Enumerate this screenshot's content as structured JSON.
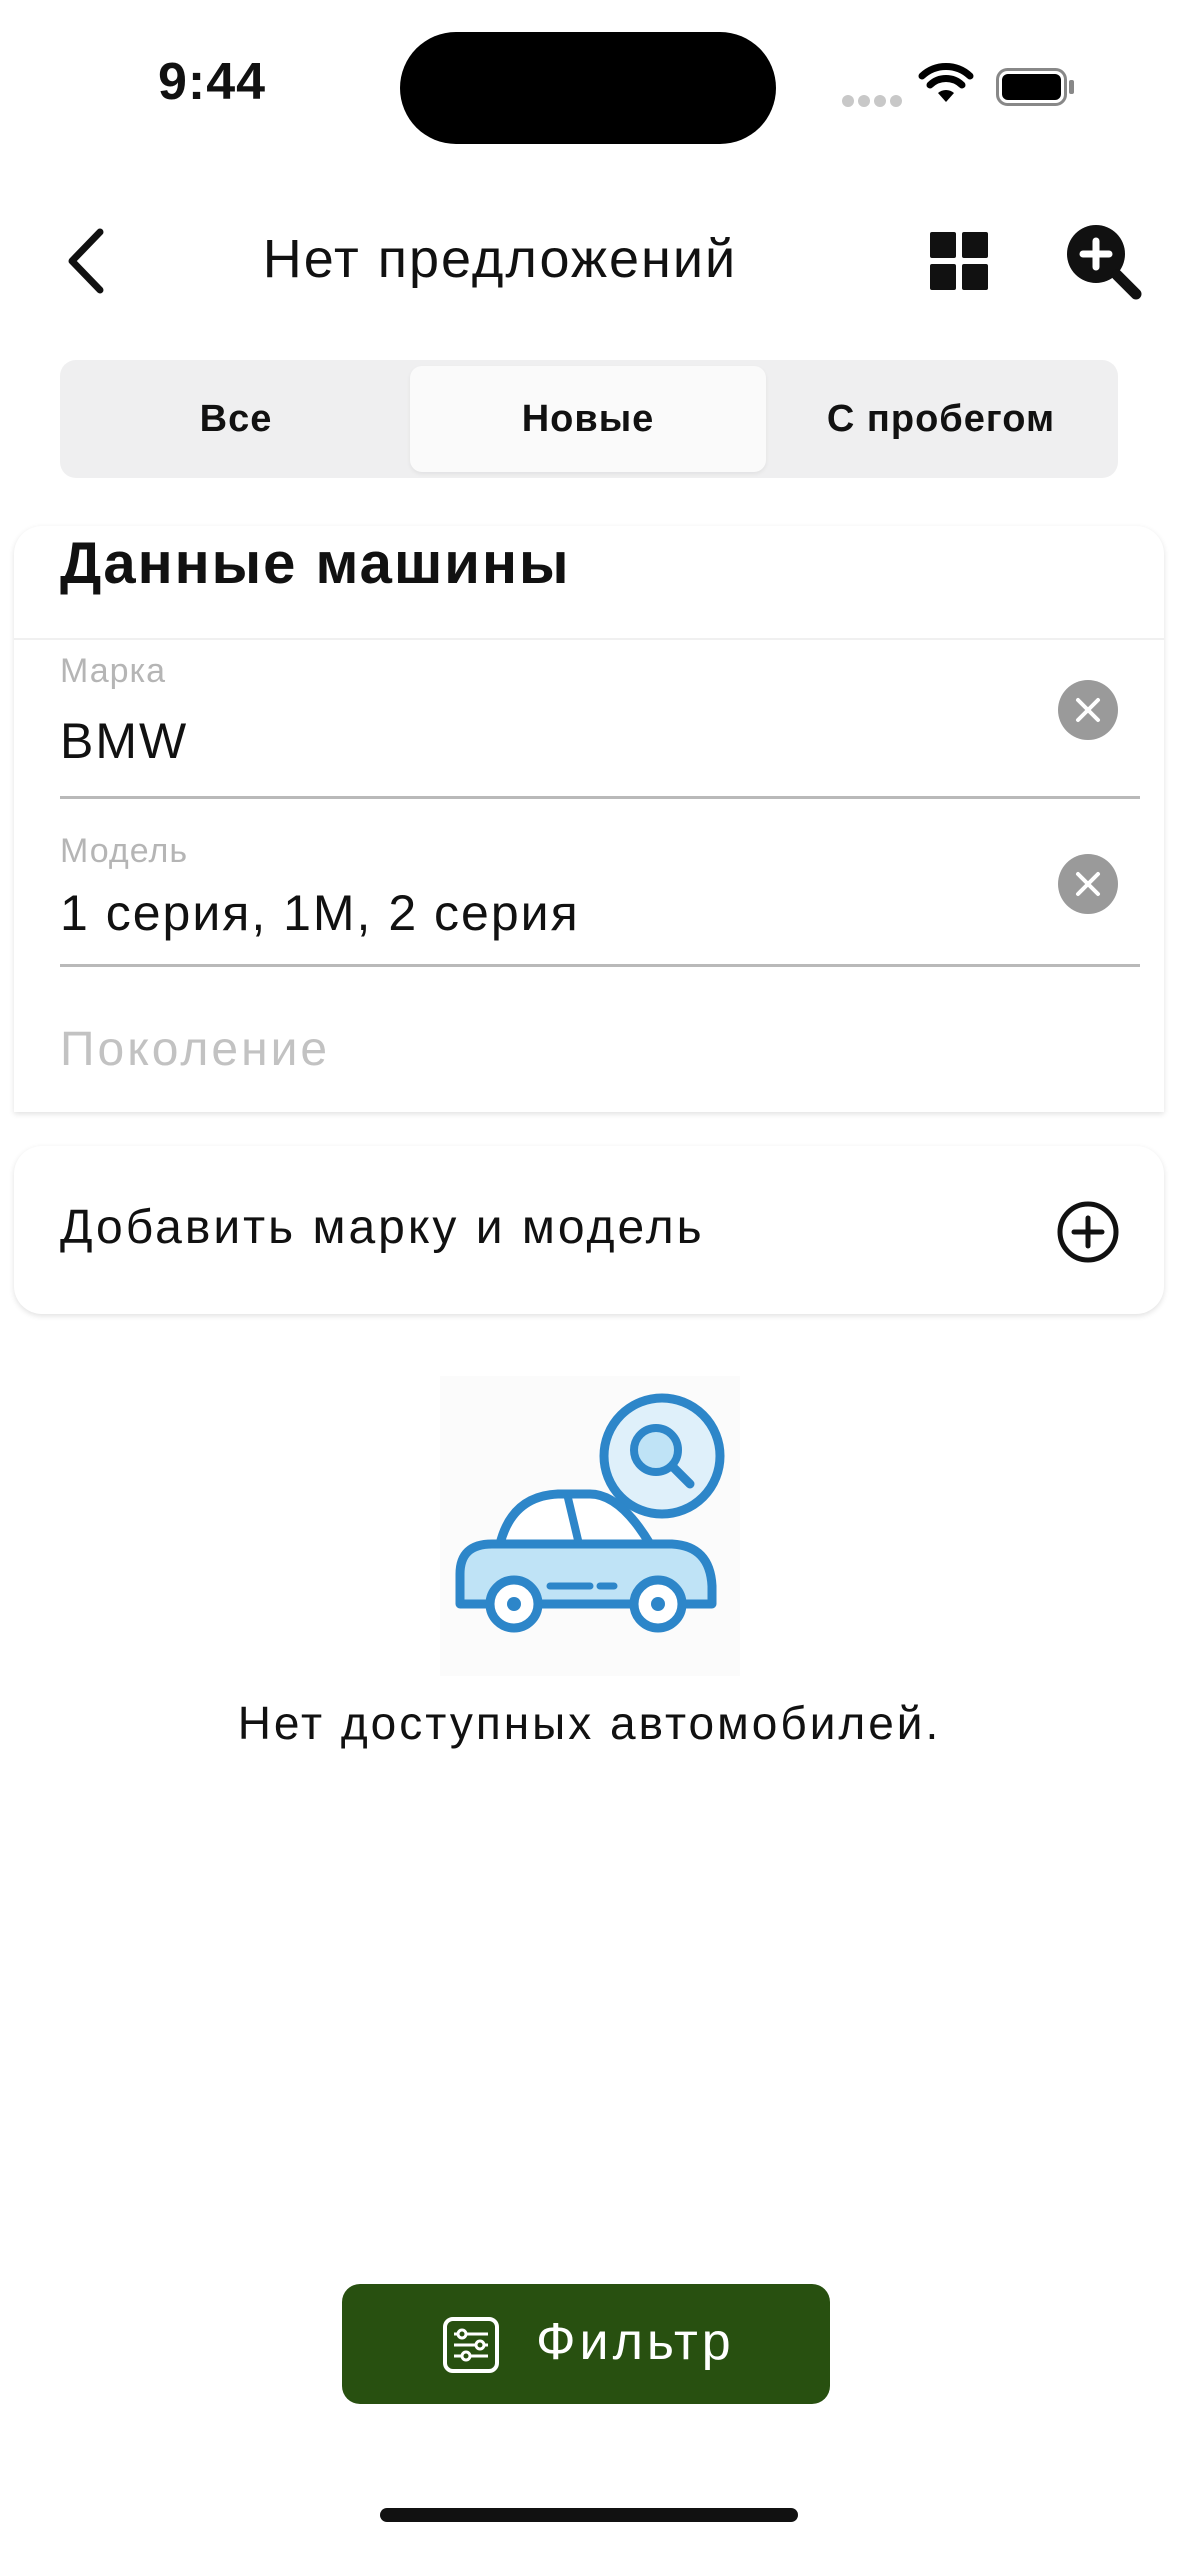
{
  "status_bar": {
    "time": "9:44"
  },
  "nav": {
    "title": "Нет предложений",
    "back_icon": "chevron-left-icon",
    "grid_icon": "grid-view-icon",
    "search_icon": "zoom-in-icon"
  },
  "segments": {
    "items": [
      {
        "label": "Все",
        "selected": false
      },
      {
        "label": "Новые",
        "selected": true
      },
      {
        "label": "С пробегом",
        "selected": false
      }
    ]
  },
  "car_data": {
    "title": "Данные машины",
    "brand": {
      "label": "Марка",
      "value": "BMW"
    },
    "model": {
      "label": "Модель",
      "value": "1 серия, 1M, 2 серия"
    },
    "generation": {
      "placeholder": "Поколение"
    }
  },
  "add_brand": {
    "label": "Добавить марку и модель",
    "icon": "plus-circle-icon"
  },
  "empty_state": {
    "message": "Нет доступных автомобилей.",
    "icon": "car-search-icon"
  },
  "filter": {
    "label": "Фильтр",
    "icon": "sliders-icon",
    "color": "#285010"
  },
  "colors": {
    "accent_blue": "#2d86c9",
    "light_blue": "#bfe3f6"
  }
}
